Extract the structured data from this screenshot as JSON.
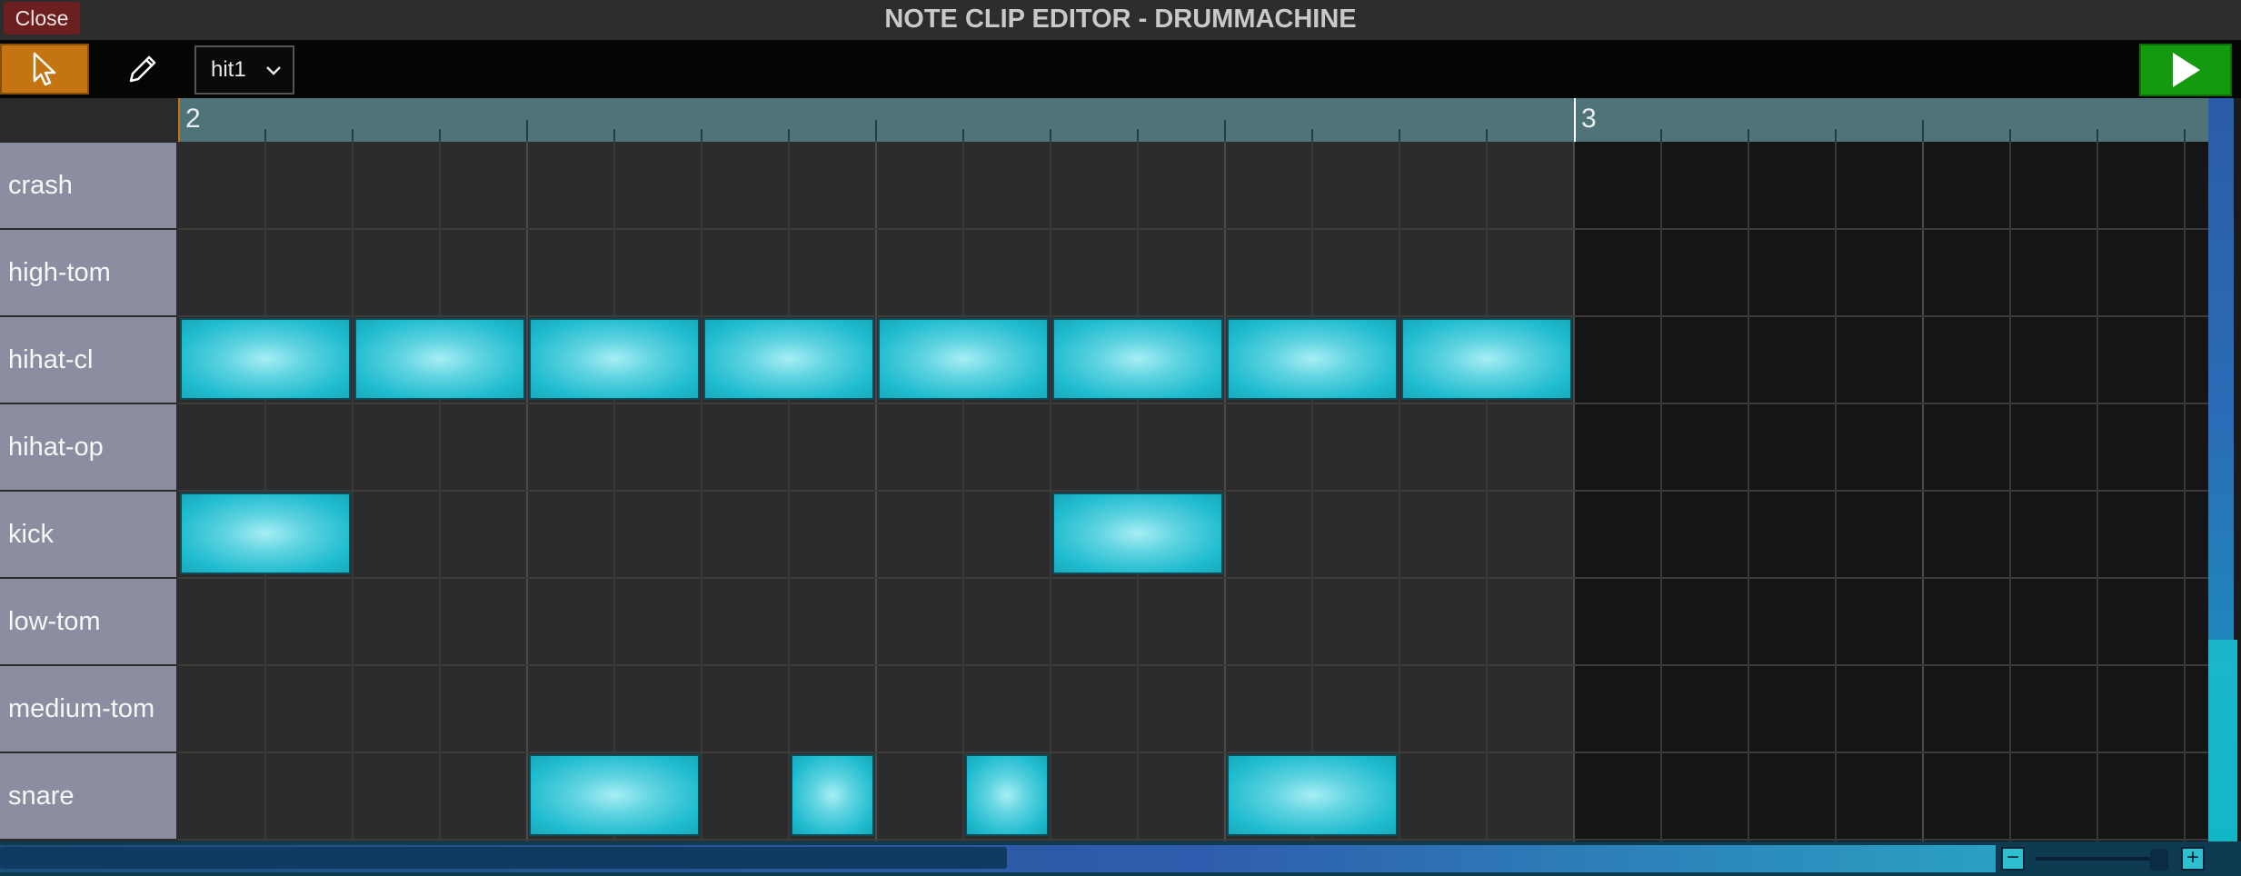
{
  "window": {
    "title": "NOTE CLIP EDITOR - DRUMMACHINE",
    "close_label": "Close"
  },
  "toolbar": {
    "tools": [
      {
        "name": "select",
        "icon": "cursor-arrow-icon",
        "active": true
      },
      {
        "name": "draw",
        "icon": "pencil-icon",
        "active": false
      }
    ],
    "clip_select": {
      "value": "hit1",
      "icon": "chevron-down-icon"
    },
    "play": {
      "icon": "play-icon",
      "color": "#139a0e"
    }
  },
  "ruler": {
    "bars": [
      "2",
      "3"
    ]
  },
  "tracks": [
    "crash",
    "high-tom",
    "hihat-cl",
    "hihat-op",
    "kick",
    "low-tom",
    "medium-tom",
    "snare"
  ],
  "clip": {
    "steps_per_bar": 16,
    "bars_visible": 2.35,
    "clip_length_steps": 16,
    "notes": [
      {
        "track": "hihat-cl",
        "start": 0,
        "length": 2
      },
      {
        "track": "hihat-cl",
        "start": 2,
        "length": 2
      },
      {
        "track": "hihat-cl",
        "start": 4,
        "length": 2
      },
      {
        "track": "hihat-cl",
        "start": 6,
        "length": 2
      },
      {
        "track": "hihat-cl",
        "start": 8,
        "length": 2
      },
      {
        "track": "hihat-cl",
        "start": 10,
        "length": 2
      },
      {
        "track": "hihat-cl",
        "start": 12,
        "length": 2
      },
      {
        "track": "hihat-cl",
        "start": 14,
        "length": 2
      },
      {
        "track": "kick",
        "start": 0,
        "length": 2
      },
      {
        "track": "kick",
        "start": 10,
        "length": 2
      },
      {
        "track": "snare",
        "start": 4,
        "length": 2
      },
      {
        "track": "snare",
        "start": 7,
        "length": 1
      },
      {
        "track": "snare",
        "start": 9,
        "length": 1
      },
      {
        "track": "snare",
        "start": 12,
        "length": 2
      }
    ]
  },
  "colors": {
    "note": "#1fbccf",
    "select_tool_active": "#c47410",
    "track_label_bg": "#8b8ea0",
    "ruler_bg": "#4e7378"
  },
  "zoom": {
    "out_label": "−",
    "in_label": "+",
    "level": 0.88
  },
  "scroll": {
    "horizontal_position": 0.0,
    "vertical_position": 0.0
  }
}
